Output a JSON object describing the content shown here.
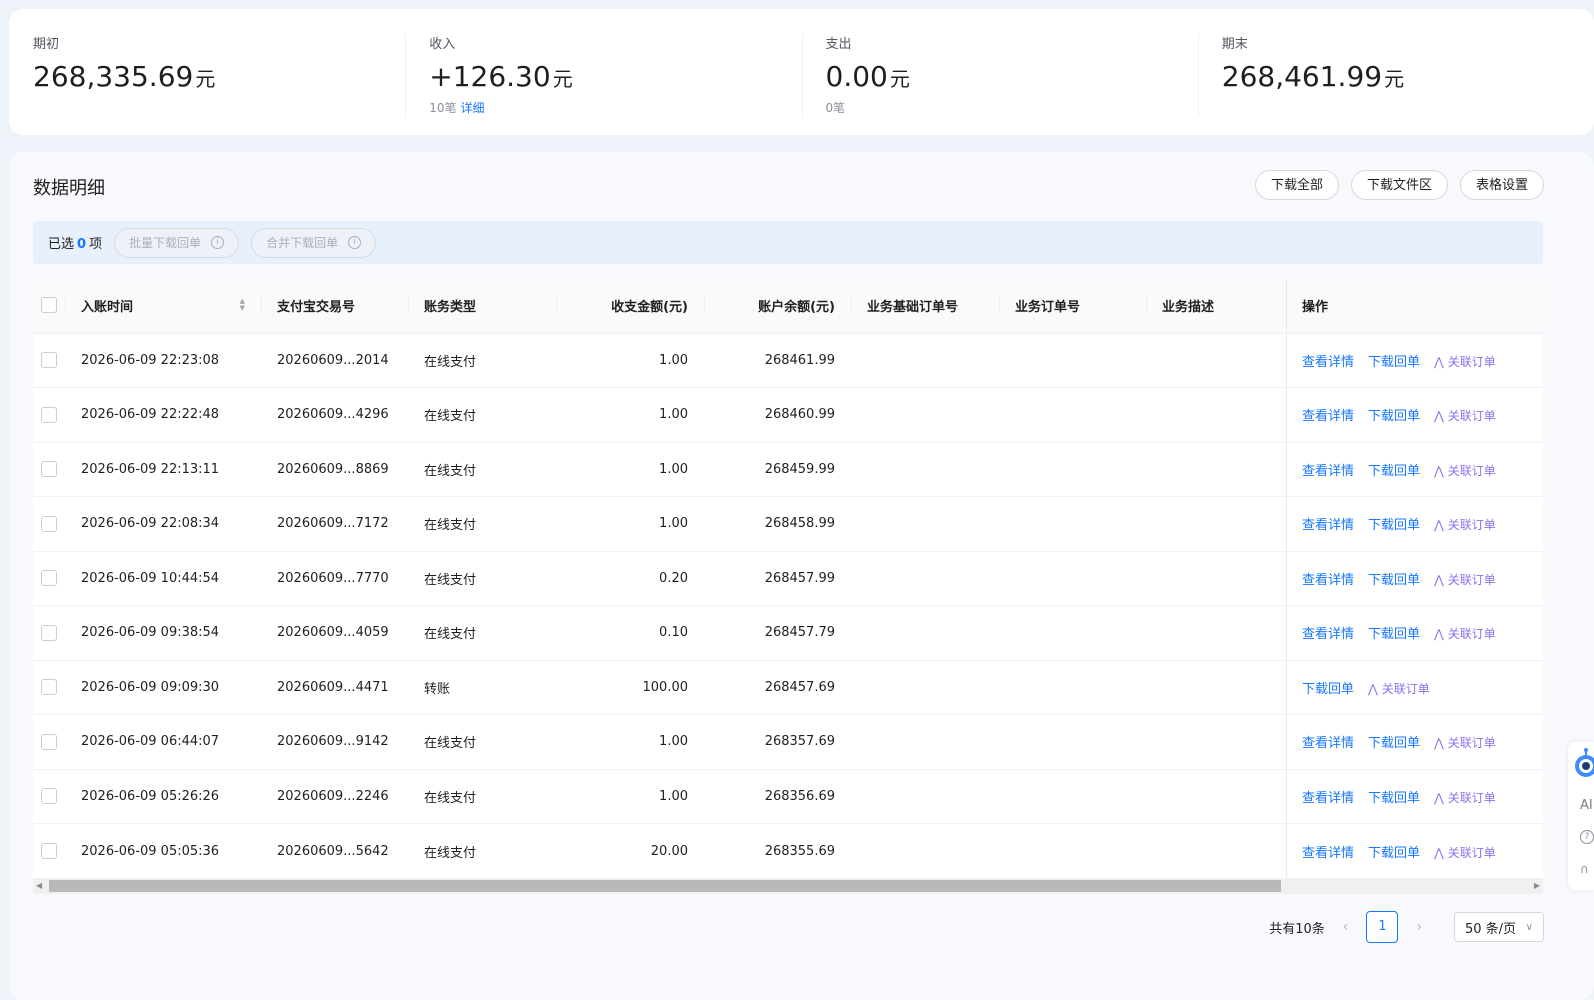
{
  "summary": [
    {
      "label": "期初",
      "value": "268,335.69",
      "unit": "元",
      "sub_count": "",
      "sub_link": ""
    },
    {
      "label": "收入",
      "value": "+126.30",
      "unit": "元",
      "sub_count": "10笔",
      "sub_link": "详细"
    },
    {
      "label": "支出",
      "value": "0.00",
      "unit": "元",
      "sub_count": "0笔",
      "sub_link": ""
    },
    {
      "label": "期末",
      "value": "268,461.99",
      "unit": "元",
      "sub_count": "",
      "sub_link": ""
    }
  ],
  "detail": {
    "title": "数据明细",
    "buttons": {
      "download_all": "下载全部",
      "download_area": "下载文件区",
      "table_settings": "表格设置"
    },
    "selection": {
      "prefix": "已选",
      "count": "0",
      "suffix": "项",
      "batch_download": "批量下载回单",
      "merge_download": "合并下载回单",
      "info_glyph": "i"
    }
  },
  "table": {
    "columns": {
      "time": "入账时间",
      "trade_no": "支付宝交易号",
      "type": "账务类型",
      "amount": "收支金额(元)",
      "balance": "账户余额(元)",
      "base_order": "业务基础订单号",
      "order_no": "业务订单号",
      "desc": "业务描述",
      "ops": "操作"
    },
    "op_labels": {
      "view": "查看详情",
      "download": "下载回单",
      "assoc": "关联订单"
    },
    "rows": [
      {
        "time": "2026-06-09 22:23:08",
        "trade_no": "20260609...2014",
        "type": "在线支付",
        "amount": "1.00",
        "balance": "268461.99",
        "view": "查看详情",
        "download": "下载回单",
        "assoc": "关联订单"
      },
      {
        "time": "2026-06-09 22:22:48",
        "trade_no": "20260609...4296",
        "type": "在线支付",
        "amount": "1.00",
        "balance": "268460.99",
        "view": "查看详情",
        "download": "下载回单",
        "assoc": "关联订单"
      },
      {
        "time": "2026-06-09 22:13:11",
        "trade_no": "20260609...8869",
        "type": "在线支付",
        "amount": "1.00",
        "balance": "268459.99",
        "view": "查看详情",
        "download": "下载回单",
        "assoc": "关联订单"
      },
      {
        "time": "2026-06-09 22:08:34",
        "trade_no": "20260609...7172",
        "type": "在线支付",
        "amount": "1.00",
        "balance": "268458.99",
        "view": "查看详情",
        "download": "下载回单",
        "assoc": "关联订单"
      },
      {
        "time": "2026-06-09 10:44:54",
        "trade_no": "20260609...7770",
        "type": "在线支付",
        "amount": "0.20",
        "balance": "268457.99",
        "view": "查看详情",
        "download": "下载回单",
        "assoc": "关联订单"
      },
      {
        "time": "2026-06-09 09:38:54",
        "trade_no": "20260609...4059",
        "type": "在线支付",
        "amount": "0.10",
        "balance": "268457.79",
        "view": "查看详情",
        "download": "下载回单",
        "assoc": "关联订单"
      },
      {
        "time": "2026-06-09 09:09:30",
        "trade_no": "20260609...4471",
        "type": "转账",
        "amount": "100.00",
        "balance": "268457.69",
        "view": "",
        "download": "下载回单",
        "assoc": "关联订单"
      },
      {
        "time": "2026-06-09 06:44:07",
        "trade_no": "20260609...9142",
        "type": "在线支付",
        "amount": "1.00",
        "balance": "268357.69",
        "view": "查看详情",
        "download": "下载回单",
        "assoc": "关联订单"
      },
      {
        "time": "2026-06-09 05:26:26",
        "trade_no": "20260609...2246",
        "type": "在线支付",
        "amount": "1.00",
        "balance": "268356.69",
        "view": "查看详情",
        "download": "下载回单",
        "assoc": "关联订单"
      },
      {
        "time": "2026-06-09 05:05:36",
        "trade_no": "20260609...5642",
        "type": "在线支付",
        "amount": "20.00",
        "balance": "268355.69",
        "view": "查看详情",
        "download": "下载回单",
        "assoc": "关联订单"
      }
    ]
  },
  "pagination": {
    "total": "共有10条",
    "current_page": "1",
    "page_size": "50 条/页"
  },
  "float_widget": {
    "ai_label": "AI"
  },
  "colors": {
    "accent": "#1677ff",
    "assoc_purple": "#8d70f0"
  }
}
